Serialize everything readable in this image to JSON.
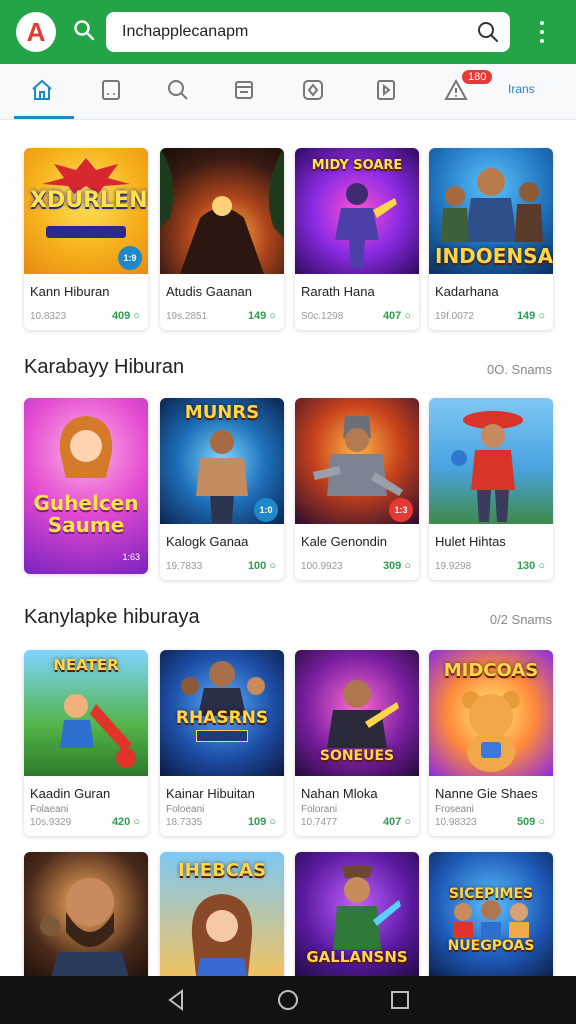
{
  "topbar": {
    "logo_letter": "A",
    "url": "Inchapplecanapm"
  },
  "tabs": {
    "badge": "180",
    "more_label": "Irans"
  },
  "colors": {
    "brand": "#22a447",
    "accent": "#1e88c8",
    "rating": "#2e9e4e",
    "badge": "#e53935"
  },
  "sections": [
    {
      "title": "",
      "link": "",
      "cards": [
        {
          "art_title": "XDURLEN",
          "name": "Kann Hiburan",
          "sub": "",
          "meta": "10.8323",
          "rating": "409",
          "corner": "1:9"
        },
        {
          "art_title": "",
          "name": "Atudis Gaanan",
          "sub": "",
          "meta": "19s.2851",
          "rating": "149",
          "corner": ""
        },
        {
          "art_title": "MIDY SOARE",
          "name": "Rarath Hana",
          "sub": "",
          "meta": "S0c.1298",
          "rating": "407",
          "corner": ""
        },
        {
          "art_title": "INDOENSA",
          "name": "Kadarhana",
          "sub": "",
          "meta": "19f.0072",
          "rating": "149",
          "corner": ""
        }
      ]
    },
    {
      "title": "Karabayy Hiburan",
      "link": "0Ο. Snams",
      "cards": [
        {
          "art_title": "Guhelcen Saume",
          "name": "",
          "sub": "",
          "meta": "",
          "rating": "",
          "corner": "1:63"
        },
        {
          "art_title": "MUNRS",
          "name": "Kalogk Ganaa",
          "sub": "",
          "meta": "19.7833",
          "rating": "100",
          "corner": "1:0"
        },
        {
          "art_title": "",
          "name": "Kale Genondin",
          "sub": "",
          "meta": "100.9923",
          "rating": "309",
          "corner": "1:3"
        },
        {
          "art_title": "",
          "name": "Hulet Hihtas",
          "sub": "",
          "meta": "19.9298",
          "rating": "130",
          "corner": ""
        }
      ]
    },
    {
      "title": "Kanylapke hiburaya",
      "link": "0/2 Snams",
      "cards": [
        {
          "art_title": "NEATER",
          "name": "Kaadin Guran",
          "sub": "Folaeani",
          "meta": "10s.9329",
          "rating": "420",
          "corner": ""
        },
        {
          "art_title": "RHASRNS",
          "name": "Kainar Hibuitan",
          "sub": "Foloeani",
          "meta": "18.7335",
          "rating": "109",
          "corner": ""
        },
        {
          "art_title": "SONEUES",
          "name": "Nahan Mloka",
          "sub": "Folorani",
          "meta": "10.7477",
          "rating": "407",
          "corner": ""
        },
        {
          "art_title": "MIDCOAS",
          "name": "Nanne Gie Shaes",
          "sub": "Froseani",
          "meta": "10.98323",
          "rating": "509",
          "corner": ""
        }
      ]
    },
    {
      "title": "",
      "link": "",
      "cards": [
        {
          "art_title": "",
          "name": "",
          "sub": "",
          "meta": "",
          "rating": "",
          "corner": ""
        },
        {
          "art_title": "IHEBCAS",
          "name": "",
          "sub": "",
          "meta": "",
          "rating": "",
          "corner": ""
        },
        {
          "art_title": "GALLANSNS",
          "name": "",
          "sub": "",
          "meta": "",
          "rating": "",
          "corner": ""
        },
        {
          "art_title": "SICEPIMES NUEGPOAS",
          "name": "",
          "sub": "",
          "meta": "",
          "rating": "",
          "corner": ""
        }
      ]
    }
  ]
}
